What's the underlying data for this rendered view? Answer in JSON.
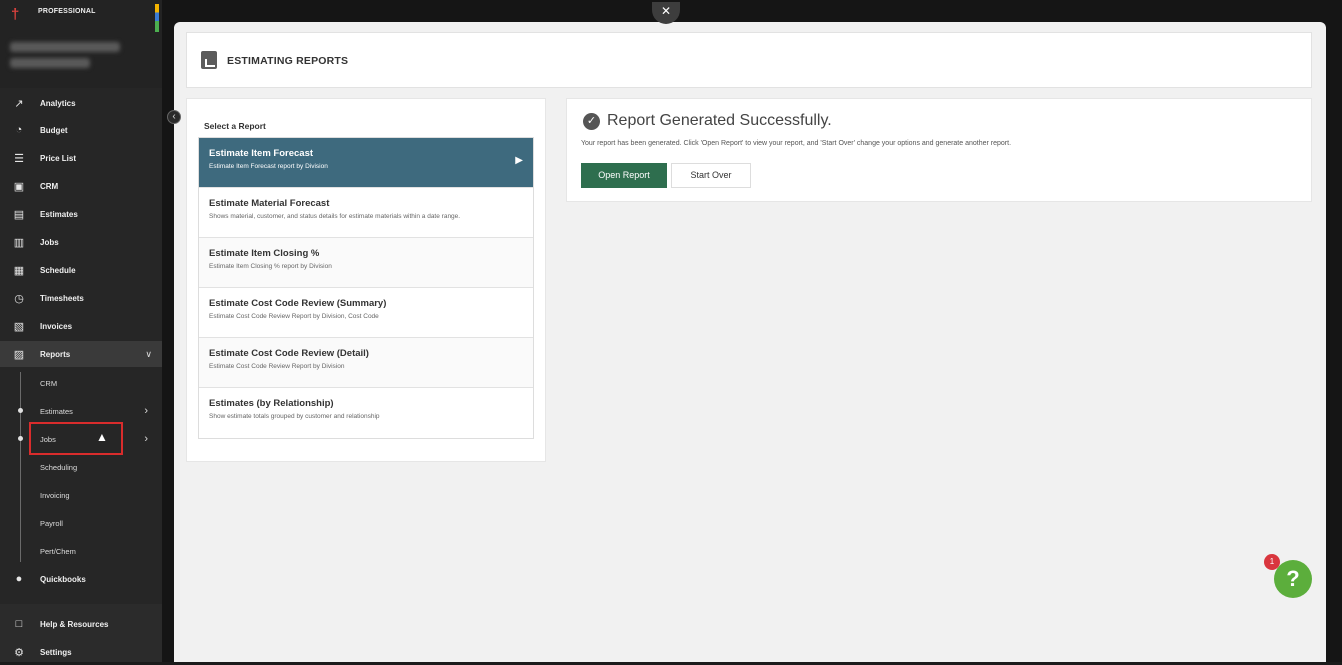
{
  "brand": {
    "tier": "PROFESSIONAL",
    "logo_icon": "shovel-icon"
  },
  "sidebar": {
    "items": [
      {
        "label": "Analytics",
        "icon": "chart-line-icon"
      },
      {
        "label": "Budget",
        "icon": "budget-icon"
      },
      {
        "label": "Price List",
        "icon": "list-icon"
      },
      {
        "label": "CRM",
        "icon": "crm-icon"
      },
      {
        "label": "Estimates",
        "icon": "estimates-icon"
      },
      {
        "label": "Jobs",
        "icon": "jobs-icon"
      },
      {
        "label": "Schedule",
        "icon": "calendar-icon"
      },
      {
        "label": "Timesheets",
        "icon": "clock-icon"
      },
      {
        "label": "Invoices",
        "icon": "invoice-icon"
      },
      {
        "label": "Reports",
        "icon": "reports-icon"
      },
      {
        "label": "Quickbooks",
        "icon": "quickbooks-icon"
      },
      {
        "label": "Help & Resources",
        "icon": "help-resources-icon"
      },
      {
        "label": "Settings",
        "icon": "gear-icon"
      }
    ],
    "reports_sub": [
      {
        "label": "CRM"
      },
      {
        "label": "Estimates"
      },
      {
        "label": "Jobs"
      },
      {
        "label": "Scheduling"
      },
      {
        "label": "Invoicing"
      },
      {
        "label": "Payroll"
      },
      {
        "label": "Pert/Chem"
      }
    ]
  },
  "header": {
    "title": "ESTIMATING REPORTS"
  },
  "report_panel": {
    "title": "Select a Report",
    "reports": [
      {
        "name": "Estimate Item Forecast",
        "desc": "Estimate Item Forecast report by Division",
        "selected": true
      },
      {
        "name": "Estimate Material Forecast",
        "desc": "Shows material, customer, and status details for estimate materials within a date range."
      },
      {
        "name": "Estimate Item Closing %",
        "desc": "Estimate Item Closing % report by Division"
      },
      {
        "name": "Estimate Cost Code Review (Summary)",
        "desc": "Estimate Cost Code Review Report by Division, Cost Code"
      },
      {
        "name": "Estimate Cost Code Review (Detail)",
        "desc": "Estimate Cost Code Review Report by Division"
      },
      {
        "name": "Estimates (by Relationship)",
        "desc": "Show estimate totals grouped by customer and relationship"
      }
    ]
  },
  "result": {
    "title": "Report Generated Successfully.",
    "description": "Your report has been generated. Click 'Open Report' to view your report, and 'Start Over' change your options and generate another report.",
    "open_label": "Open Report",
    "start_over_label": "Start Over"
  },
  "help": {
    "badge": "1",
    "label": "?"
  },
  "colors": {
    "accent": "#2e6e4e",
    "selected_row": "#3e6a7e",
    "help": "#5cae3c",
    "badge": "#d9363e",
    "highlight": "#d92c2c"
  }
}
